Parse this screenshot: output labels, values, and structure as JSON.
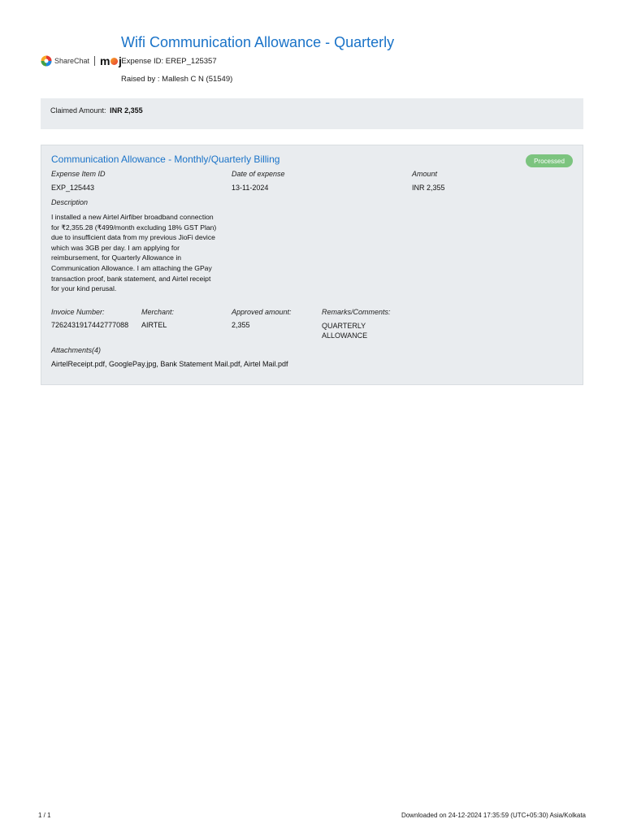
{
  "header": {
    "title": "Wifi Communication Allowance - Quarterly",
    "brand_sharechat": "ShareChat",
    "brand_moj_m": "m",
    "brand_moj_j": "j",
    "expense_id": "Expense ID: EREP_125357",
    "raised_by": "Raised by : Mallesh C N (51549)"
  },
  "claimed": {
    "label": "Claimed Amount:",
    "value": "INR 2,355"
  },
  "item": {
    "title": "Communication Allowance - Monthly/Quarterly Billing",
    "status": "Processed",
    "status_color": "#7cc47f",
    "expense_item_id_label": "Expense Item ID",
    "expense_item_id": "EXP_125443",
    "date_label": "Date of expense",
    "date": "13-11-2024",
    "amount_label": "Amount",
    "amount": "INR 2,355",
    "description_label": "Description",
    "description": "I installed a new Airtel Airfiber broadband connection for ₹2,355.28 (₹499/month excluding 18% GST Plan) due to insufficient data from my previous JioFi device which was 3GB per day. I am applying for reimbursement, for Quarterly Allowance in Communication Allowance. I am attaching the GPay transaction proof, bank statement, and Airtel receipt for your kind perusal.",
    "invoice_label": "Invoice Number:",
    "invoice": "7262431917442777088",
    "merchant_label": "Merchant:",
    "merchant": "AIRTEL",
    "approved_label": "Approved amount:",
    "approved": "2,355",
    "remarks_label": "Remarks/Comments:",
    "remarks": "QUARTERLY ALLOWANCE",
    "attachments_label": "Attachments(4)",
    "attachments": "AirtelReceipt.pdf, GooglePay.jpg, Bank Statement Mail.pdf, Airtel Mail.pdf"
  },
  "footer": {
    "page": "1 / 1",
    "downloaded": "Downloaded on 24-12-2024 17:35:59 (UTC+05:30) Asia/Kolkata"
  },
  "colors": {
    "accent": "#1a73c8",
    "panel": "#e9ecef"
  }
}
